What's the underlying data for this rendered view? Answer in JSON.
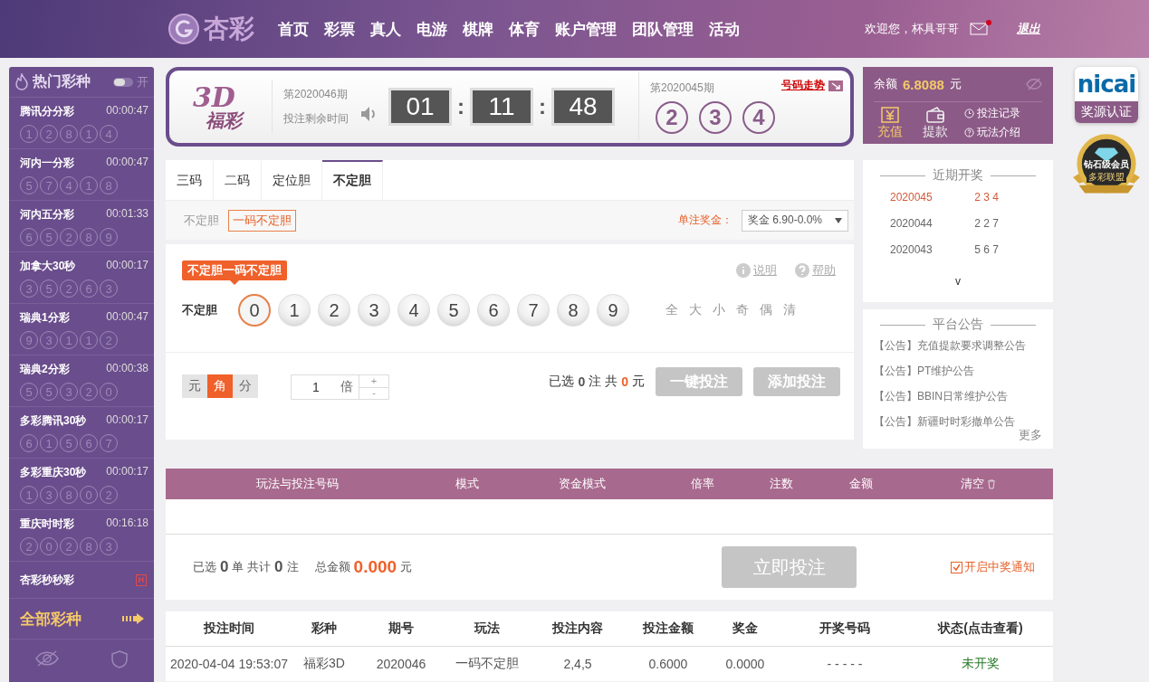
{
  "header": {
    "logo_text": "杏彩",
    "nav": [
      "首页",
      "彩票",
      "真人",
      "电游",
      "棋牌",
      "体育",
      "账户管理",
      "团队管理",
      "活动"
    ],
    "welcome": "欢迎您，杯具哥哥",
    "mail_unread": true,
    "logout": "退出"
  },
  "sidebar": {
    "title": "热门彩种",
    "toggle": {
      "label": "开",
      "on": false
    },
    "lotteries": [
      {
        "name": "腾讯分分彩",
        "time": "00:00:47",
        "balls": [
          "1",
          "2",
          "8",
          "1",
          "4"
        ]
      },
      {
        "name": "河内一分彩",
        "time": "00:00:47",
        "balls": [
          "5",
          "7",
          "4",
          "1",
          "8"
        ]
      },
      {
        "name": "河内五分彩",
        "time": "00:01:33",
        "balls": [
          "6",
          "5",
          "2",
          "8",
          "9"
        ]
      },
      {
        "name": "加拿大30秒",
        "time": "00:00:17",
        "balls": [
          "3",
          "5",
          "2",
          "6",
          "3"
        ]
      },
      {
        "name": "瑞典1分彩",
        "time": "00:00:47",
        "balls": [
          "9",
          "3",
          "1",
          "1",
          "2"
        ]
      },
      {
        "name": "瑞典2分彩",
        "time": "00:00:38",
        "balls": [
          "5",
          "5",
          "3",
          "2",
          "0"
        ]
      },
      {
        "name": "多彩腾讯30秒",
        "time": "00:00:17",
        "balls": [
          "6",
          "1",
          "5",
          "6",
          "7"
        ]
      },
      {
        "name": "多彩重庆30秒",
        "time": "00:00:17",
        "balls": [
          "1",
          "3",
          "8",
          "0",
          "2"
        ]
      },
      {
        "name": "重庆时时彩",
        "time": "00:16:18",
        "balls": [
          "2",
          "0",
          "2",
          "8",
          "3"
        ]
      }
    ],
    "special": {
      "name": "杏彩秒秒彩",
      "badge": "H"
    },
    "all_link": "全部彩种"
  },
  "draw": {
    "logo_top": "3D",
    "logo_bottom": "福彩",
    "current_issue": "第2020046期",
    "remaining_label": "投注剩余时间",
    "countdown": [
      "01",
      "11",
      "48"
    ],
    "separator": ":",
    "last_issue": "第2020045期",
    "last_numbers": [
      "2",
      "3",
      "4"
    ],
    "trend_link": "号码走势"
  },
  "tabs": [
    {
      "label": "三码",
      "selected": false
    },
    {
      "label": "二码",
      "selected": false
    },
    {
      "label": "定位胆",
      "selected": false
    },
    {
      "label": "不定胆",
      "selected": true
    }
  ],
  "subtabs": {
    "group": "不定胆",
    "options": [
      {
        "label": "一码不定胆",
        "selected": true
      }
    ],
    "prize_label": "单注奖金：",
    "prize_select": "奖金 6.90-0.0%"
  },
  "picker": {
    "tooltip": "不定胆一码不定胆",
    "help_links": [
      "说明",
      "帮助"
    ],
    "row_label": "不定胆",
    "balls": [
      {
        "label": "0",
        "selected": true
      },
      {
        "label": "1",
        "selected": false
      },
      {
        "label": "2",
        "selected": false
      },
      {
        "label": "3",
        "selected": false
      },
      {
        "label": "4",
        "selected": false
      },
      {
        "label": "5",
        "selected": false
      },
      {
        "label": "6",
        "selected": false
      },
      {
        "label": "7",
        "selected": false
      },
      {
        "label": "8",
        "selected": false
      },
      {
        "label": "9",
        "selected": false
      }
    ],
    "quick": [
      "全",
      "大",
      "小",
      "奇",
      "偶",
      "清"
    ]
  },
  "bet_bar": {
    "units": [
      {
        "label": "元",
        "selected": false
      },
      {
        "label": "角",
        "selected": true
      },
      {
        "label": "分",
        "selected": false
      }
    ],
    "multiplier": "1",
    "multiplier_unit": "倍",
    "plus": "+",
    "minus": "-",
    "summary": [
      {
        "text": "已选",
        "kind": "plain"
      },
      {
        "text": "0",
        "kind": "count"
      },
      {
        "text": "注",
        "kind": "plain"
      },
      {
        "text": "共",
        "kind": "plain"
      },
      {
        "text": "0",
        "kind": "money"
      },
      {
        "text": "元",
        "kind": "plain"
      }
    ],
    "buttons": [
      {
        "label": "一键投注",
        "disabled": true
      },
      {
        "label": "添加投注",
        "disabled": true
      }
    ]
  },
  "account": {
    "balance_label": "余额",
    "balance": "6.8088",
    "currency": "元",
    "actions": [
      {
        "label": "充值",
        "kind": "deposit",
        "selected": true
      },
      {
        "label": "提款",
        "kind": "withdraw",
        "selected": false
      }
    ],
    "links": [
      {
        "label": "投注记录",
        "kind": "clock"
      },
      {
        "label": "玩法介绍",
        "kind": "help"
      }
    ]
  },
  "recent": {
    "title": "近期开奖",
    "rows": [
      {
        "issue": "2020045",
        "numbers": "2 3 4",
        "latest": true
      },
      {
        "issue": "2020044",
        "numbers": "2 2 7",
        "latest": false
      },
      {
        "issue": "2020043",
        "numbers": "5 6 7",
        "latest": false
      }
    ],
    "expand": "v"
  },
  "notices": {
    "title": "平台公告",
    "items": [
      "【公告】充值提款要求调整公告",
      "【公告】PT维护公告",
      "【公告】BBIN日常维护公告",
      "【公告】新疆时时彩撤单公告"
    ],
    "more": "更多"
  },
  "cart": {
    "columns": [
      "玩法与投注号码",
      "模式",
      "资金模式",
      "倍率",
      "注数",
      "金额",
      "清空"
    ],
    "summary": [
      {
        "text": "已选",
        "kind": "plain"
      },
      {
        "text": "0",
        "kind": "count"
      },
      {
        "text": "单 共计",
        "kind": "plain"
      },
      {
        "text": "0",
        "kind": "count"
      },
      {
        "text": "注",
        "kind": "plain"
      },
      {
        "text": "总金额",
        "kind": "gap"
      },
      {
        "text": "0.000",
        "kind": "money"
      },
      {
        "text": "元",
        "kind": "plain"
      }
    ],
    "submit": {
      "label": "立即投注",
      "disabled": true
    },
    "notify": {
      "label": "开启中奖通知",
      "checked": true
    }
  },
  "history": {
    "columns": [
      "投注时间",
      "彩种",
      "期号",
      "玩法",
      "投注内容",
      "投注金额",
      "奖金",
      "开奖号码",
      "状态(点击查看)"
    ],
    "rows": [
      {
        "cells": [
          "2020-04-04 19:53:07",
          "福彩3D",
          "2020046",
          "一码不定胆",
          "2,4,5",
          "0.6000",
          "0.0000",
          "- - - - -",
          "未开奖"
        ],
        "drawn": false
      }
    ]
  },
  "badges": {
    "brand": "nicai",
    "cert": "奖源认证",
    "member": "钻石级会员",
    "alliance": "多彩联盟"
  }
}
